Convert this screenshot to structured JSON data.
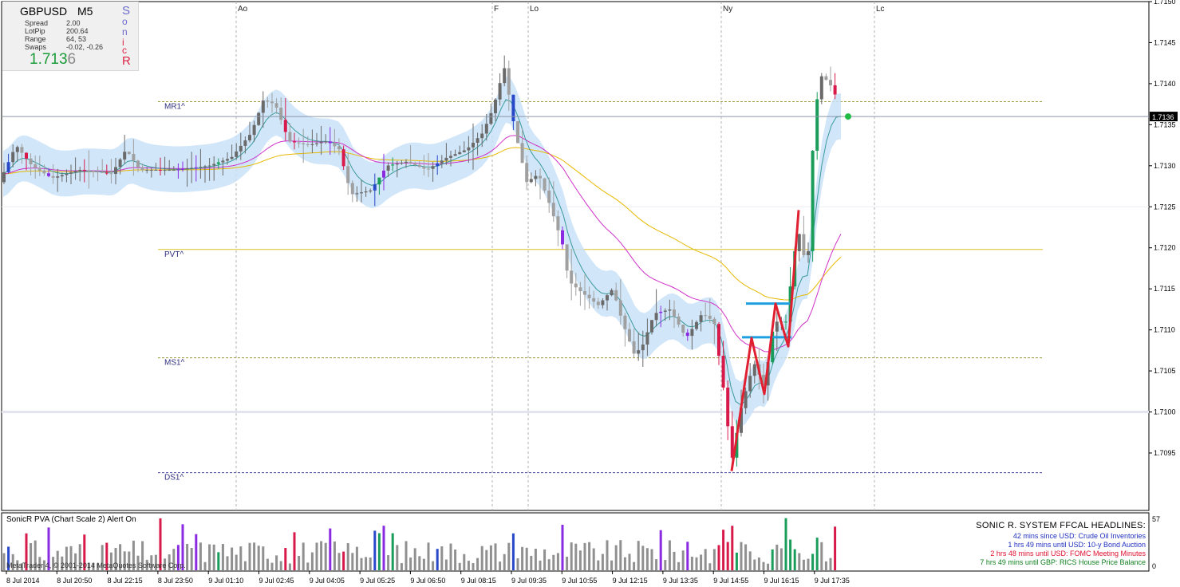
{
  "symbol": "GBPUSD",
  "timeframe": "M5",
  "info": {
    "rows": [
      {
        "label": "Spread",
        "value": "2.00"
      },
      {
        "label": "LotPip",
        "value": "200.64"
      },
      {
        "label": "Range",
        "value": "64, 53"
      },
      {
        "label": "Swaps",
        "value": "-0.02, -0.26"
      }
    ],
    "price_main": "1.713",
    "price_tail": "6",
    "sonic_letters": [
      "S",
      "o",
      "n",
      "i",
      "c",
      "R"
    ]
  },
  "chart_data": {
    "type": "candlestick",
    "ylim": [
      1.7088,
      1.715
    ],
    "yticks": [
      "1.7150",
      "1.7145",
      "1.7140",
      "1.7135",
      "1.7130",
      "1.7125",
      "1.7120",
      "1.7115",
      "1.7110",
      "1.7105",
      "1.7100",
      "1.7095"
    ],
    "current_price_label": "1.7136",
    "current_price": 1.7136,
    "xticks": [
      "8 Jul 2014",
      "8 Jul 20:50",
      "8 Jul 22:15",
      "8 Jul 23:50",
      "9 Jul 01:10",
      "9 Jul 02:45",
      "9 Jul 04:05",
      "9 Jul 05:25",
      "9 Jul 06:50",
      "9 Jul 08:15",
      "9 Jul 09:35",
      "9 Jul 10:55",
      "9 Jul 12:15",
      "9 Jul 13:35",
      "9 Jul 14:55",
      "9 Jul 16:15",
      "9 Jul 17:35"
    ],
    "sessions": [
      "Ao",
      "F",
      "Lo",
      "Ny",
      "Lc"
    ],
    "levels": [
      {
        "label": "MR1^",
        "value": 1.71378,
        "color": "#9a9a3a"
      },
      {
        "label": "PVT^",
        "value": 1.71198,
        "color": "#d8c020"
      },
      {
        "label": "MS1^",
        "value": 1.71066,
        "color": "#9a9a3a"
      },
      {
        "label": "DS1^",
        "value": 1.70926,
        "color": "#4a4aa0"
      }
    ],
    "series_colors": {
      "ema_band": "#c9e2f8",
      "ema_line": "#3a9a9a",
      "magenta": "#d030c8",
      "gold": "#e8b800",
      "zigzag": "#e02030",
      "flat_lines": "#1ea0e0",
      "bull": "#1a9c5a",
      "bear": "#d81a4a",
      "climax_up": "#8a2be2",
      "climax_down": "#2848c8"
    }
  },
  "subwindow": {
    "title": "SonicR PVA  (Chart Scale 2)   Alert On",
    "scale_max": "57",
    "scale_min": "0",
    "copyright": "MetaTrader 4, © 2001-2014 MetaQuotes Software Corp."
  },
  "headlines": {
    "title": "SONIC R. SYSTEM  FFCAL HEADLINES:",
    "items": [
      {
        "text": "42 mins since USD: Crude Oil Inventories",
        "color": "#2030c0"
      },
      {
        "text": "1 hrs 49 mins until USD: 10-y Bond Auction",
        "color": "#2030c0"
      },
      {
        "text": "2 hrs 48 mins until USD: FOMC Meeting Minutes",
        "color": "#e01030"
      },
      {
        "text": "7 hrs 49 mins until GBP: RICS House Price Balance",
        "color": "#108020"
      }
    ]
  }
}
